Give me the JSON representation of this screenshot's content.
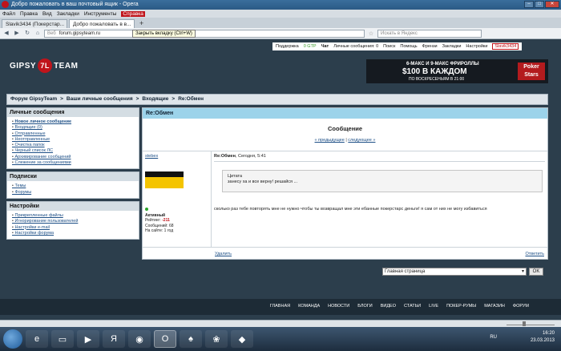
{
  "window": {
    "title": "Добро пожаловать в ваш почтовый ящик - Opera"
  },
  "menu": [
    "Файл",
    "Правка",
    "Вид",
    "Закладки",
    "Инструменты",
    "Справка"
  ],
  "tabs": [
    {
      "label": "Slavik3434 (Покерстар..."
    },
    {
      "label": "Добро пожаловать в в..."
    }
  ],
  "address": {
    "web_label": "Веб",
    "url": "forum.gipsyteam.ru",
    "search_placeholder": "Искать в Яндекс"
  },
  "tooltip": "Закрыть вкладку (Ctrl+W)",
  "topnav": [
    "Поддержка",
    "0 GTP",
    "Чат",
    "Личные сообщения: 0",
    "Поиск",
    "Помощь",
    "Френзи",
    "Закладки",
    "Настройки",
    "Slavik3434"
  ],
  "brand": {
    "left": "GIPSY",
    "mark": "7L",
    "right": "TEAM"
  },
  "banner": {
    "line1": "6-МАКС И 9-МАКС ФРИРОЛЛЫ",
    "line2": "$100 В КАЖДОМ",
    "line3": "ПО ВОСКРЕСЕНЬЯМ В 21:00",
    "ps_top": "Poker",
    "ps_bottom": "Stars"
  },
  "breadcrumb": [
    "Форум GipsyTeam",
    ">",
    "Ваши личные сообщения",
    ">",
    "Входящие",
    ">",
    "Re:Обмен"
  ],
  "sidebar": {
    "messages": {
      "title": "Личные сообщения",
      "items": [
        "Новое личное сообщение",
        "Входящие (0)",
        "Отправленные",
        "Неотправленные",
        "Очистка папок",
        "Черный список ЛС",
        "Архивирование сообщений",
        "Слежение за сообщениями"
      ]
    },
    "subs": {
      "title": "Подписки",
      "items": [
        "Темы",
        "Форумы"
      ]
    },
    "settings": {
      "title": "Настройки",
      "items": [
        "Прикрепленные файлы",
        "Игнорирование пользователей",
        "Настройки e-mail",
        "Настройки форума"
      ]
    }
  },
  "main": {
    "header": "Re:Обмен",
    "title": "Сообщение",
    "prev": "« предыдущее",
    "sep": "|",
    "next": "следующее »",
    "author": "stebex",
    "status": "Активный",
    "rating_label": "Рейтинг:",
    "rating": "-211",
    "posts": "Сообщений: 68",
    "onsite": "На сайте: 1 год",
    "subject": "Re:Обмен",
    "date": ", Сегодня, 5:41",
    "quote_label": "Цитата",
    "quote_text": "занесу ха и все верну! решайся ...",
    "text": "сколько раз тебе повторять мне не нужно чтобы ты возвращал мне эти ебанные покерстарс деньги! я сам от них не могу избавиться",
    "delete": "Удалить",
    "reply": "Ответить"
  },
  "jump": {
    "selected": "Главная страница",
    "ok": "OK"
  },
  "footer": [
    "ГЛАВНАЯ",
    "КОМАНДА",
    "НОВОСТИ",
    "БЛОГИ",
    "ВИДЕО",
    "СТАТЬИ",
    "LIVE",
    "ПОКЕР-РУМЫ",
    "МАГАЗИН",
    "ФОРУМ"
  ],
  "tray": {
    "lang": "RU",
    "time": "16:20",
    "date": "23.03.2013"
  },
  "colors": {
    "accent": "#c0141b",
    "header_blue": "#9cd3ea",
    "page_bg": "#2c3e4c"
  }
}
